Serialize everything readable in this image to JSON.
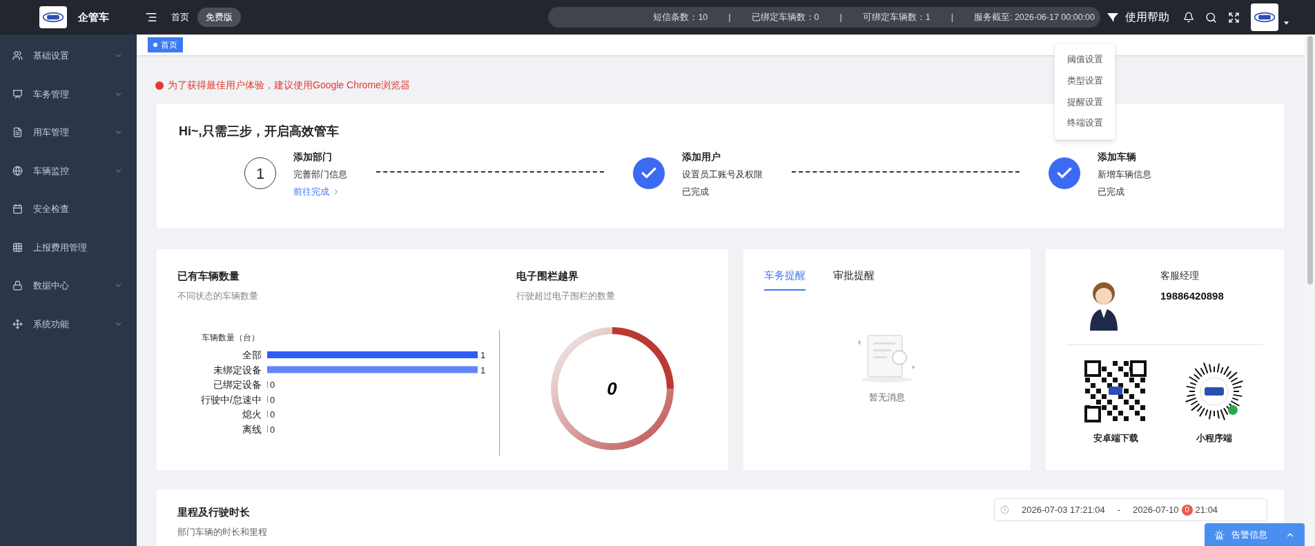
{
  "header": {
    "app_name": "企管车",
    "nav_link": "首页",
    "plan_badge": "免费版",
    "stats": [
      "短信条数：10",
      "已绑定车辆数：0",
      "可绑定车辆数：1",
      "服务截至: 2026-06-17 00:00:00"
    ],
    "separator": "|",
    "help": "使用帮助"
  },
  "settings_menu": {
    "items": [
      "阈值设置",
      "类型设置",
      "提醒设置",
      "终端设置"
    ]
  },
  "sidebar": {
    "items": [
      {
        "label": "基础设置",
        "kind": "menu"
      },
      {
        "label": "车务管理",
        "kind": "menu"
      },
      {
        "label": "用车管理",
        "kind": "menu"
      },
      {
        "label": "车辆监控",
        "kind": "menu"
      },
      {
        "label": "安全检查",
        "kind": "link"
      },
      {
        "label": "上报费用管理",
        "kind": "link"
      },
      {
        "label": "数据中心",
        "kind": "menu"
      },
      {
        "label": "系统功能",
        "kind": "menu"
      }
    ]
  },
  "breadcrumb_tabs": [
    {
      "label": "首页",
      "selected": true
    }
  ],
  "alert": "为了获得最佳用户体验，建议使用Google Chrome浏览器",
  "onboarding": {
    "title": "Hi~,只需三步，开启高效管车",
    "steps": [
      {
        "kind": "number",
        "number": "1",
        "title": "添加部门",
        "description": "完善部门信息",
        "status": "前往完成"
      },
      {
        "kind": "done",
        "title": "添加用户",
        "description": "设置员工账号及权限",
        "status": "已完成"
      },
      {
        "kind": "done",
        "title": "添加车辆",
        "description": "新增车辆信息",
        "status": "已完成"
      }
    ]
  },
  "vehicles": {
    "title": "已有车辆数量",
    "subtitle": "不同状态的车辆数量",
    "chart_data": {
      "type": "bar",
      "orientation": "horizontal",
      "title": "车辆数量（台）",
      "categories": [
        "全部",
        "未绑定设备",
        "已绑定设备",
        "行驶中/怠速中",
        "熄火",
        "离线"
      ],
      "series": [
        {
          "color": "#2f5cf5",
          "values": [
            1,
            1,
            0,
            0,
            0,
            0
          ]
        }
      ],
      "xlim": [
        0,
        1
      ],
      "data_labels": true
    }
  },
  "geofence": {
    "title": "电子围栏越界",
    "subtitle": "行驶超过电子围栏的数量",
    "value": "0"
  },
  "reminders": {
    "tabs": [
      {
        "label": "车务提醒",
        "selected": true
      },
      {
        "label": "审批提醒",
        "selected": false
      }
    ],
    "empty_text": "暂无消息"
  },
  "contact": {
    "role": "客服经理",
    "phone": "19886420898",
    "codes": [
      {
        "kind": "qr",
        "label": "安卓端下载"
      },
      {
        "kind": "mini",
        "label": "小程序端"
      }
    ]
  },
  "mileage": {
    "title": "里程及行驶时长",
    "subtitle": "部门车辆的时长和里程",
    "start": "2026-07-03 17:21:04",
    "range_separator": "-",
    "end_date": "2026-07-10",
    "end_time_visible": "21:04",
    "badge": "0"
  },
  "alarm_button": {
    "label": "告警信息"
  }
}
